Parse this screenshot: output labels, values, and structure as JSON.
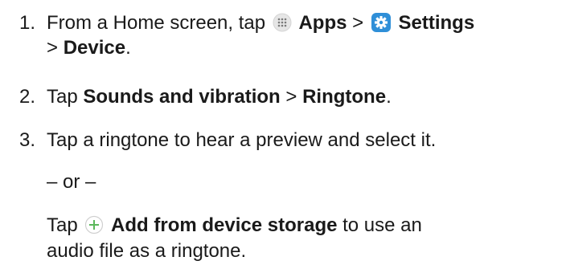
{
  "steps": [
    {
      "number": "1.",
      "prefix": "From a Home screen, tap",
      "apps_label": "Apps",
      "sep1": ">",
      "settings_label": "Settings",
      "sep2": ">",
      "device_label": "Device",
      "end": "."
    },
    {
      "number": "2.",
      "prefix": "Tap",
      "sounds_label": "Sounds and vibration",
      "sep": ">",
      "ringtone_label": "Ringtone",
      "end": "."
    },
    {
      "number": "3.",
      "text": "Tap a ringtone to hear a preview and select it."
    }
  ],
  "or_text": "– or –",
  "alt": {
    "prefix": "Tap",
    "add_label": "Add from device storage",
    "suffix_line1": "to use an",
    "line2": "audio file as a ringtone."
  },
  "colors": {
    "text": "#1a1a1a",
    "settings_icon_bg": "#2f8fd8",
    "plus_icon": "#5cb85c",
    "apps_icon_bg": "#e6e6e6"
  },
  "icons": [
    "apps-icon",
    "settings-icon",
    "plus-icon"
  ]
}
